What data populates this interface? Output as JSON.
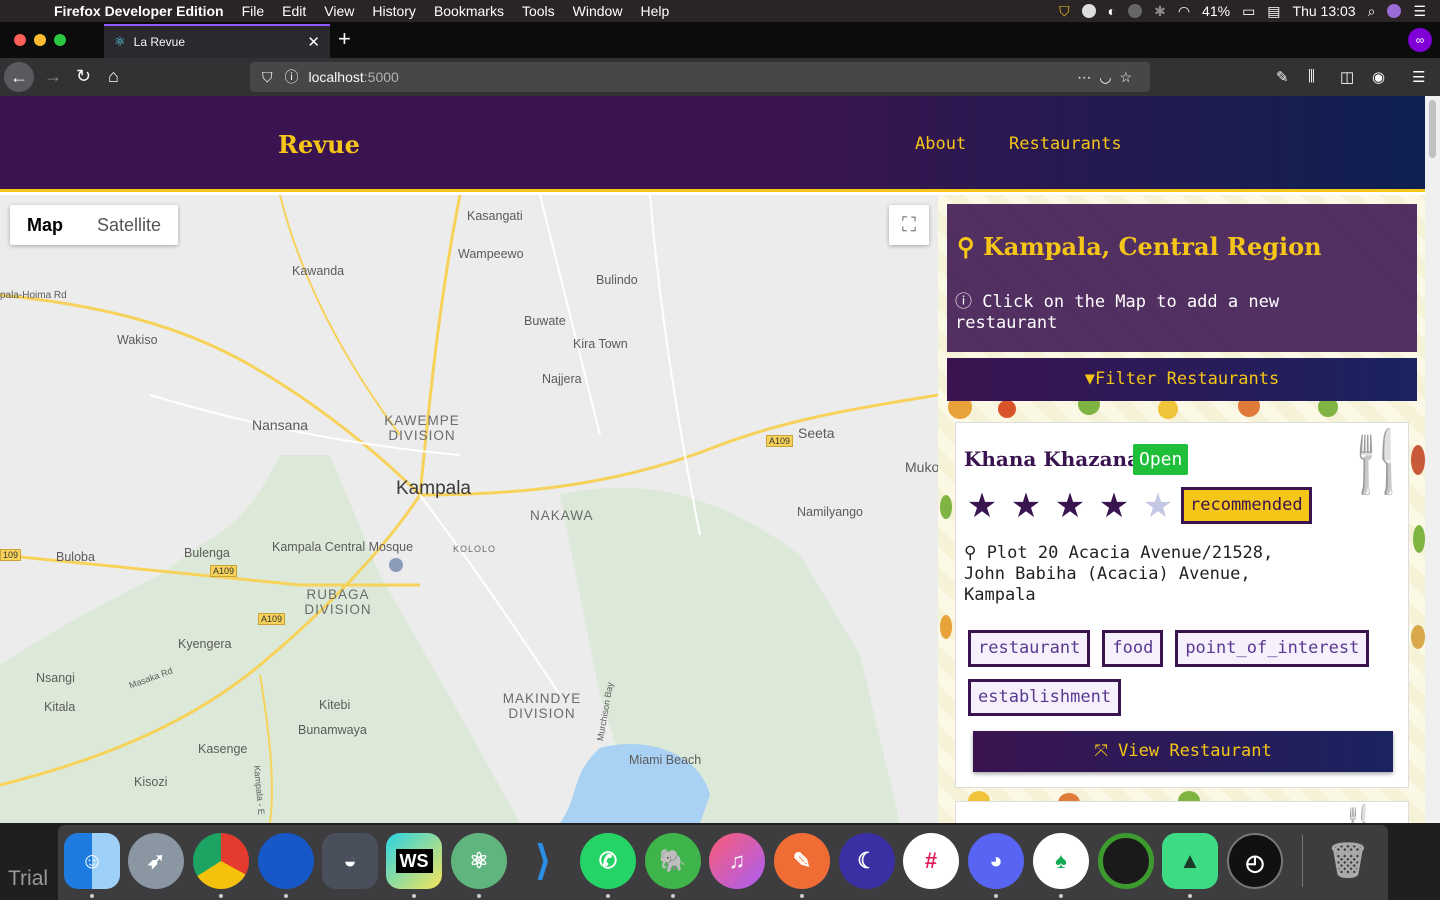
{
  "macos_menubar": {
    "app_name": "Firefox Developer Edition",
    "menus": [
      "File",
      "Edit",
      "View",
      "History",
      "Bookmarks",
      "Tools",
      "Window",
      "Help"
    ],
    "battery": "41%",
    "clock": "Thu 13:03"
  },
  "browser": {
    "tab_title": "La Revue",
    "url_host": "localhost",
    "url_port": ":5000"
  },
  "site": {
    "brand": "Revue",
    "nav": [
      "About",
      "Restaurants"
    ]
  },
  "map": {
    "type_buttons": [
      "Map",
      "Satellite"
    ],
    "selected_type": "Map",
    "labels": {
      "kasangati": "Kasangati",
      "wampeewo": "Wampeewo",
      "kawanda": "Kawanda",
      "bulindo": "Bulindo",
      "hoima_rd": "pala-Hoima Rd",
      "wakiso": "Wakiso",
      "buwate": "Buwate",
      "kira_town": "Kira Town",
      "najjera": "Najjera",
      "nansana": "Nansana",
      "kawempe": "KAWEMPE DIVISION",
      "seeta": "Seeta",
      "muko": "Muko",
      "kampala": "Kampala",
      "nakawa": "NAKAWA",
      "namilyango": "Namilyango",
      "buloba": "Buloba",
      "bulenga": "Bulenga",
      "mosque": "Kampala Central Mosque",
      "kololo": "KOLOLO",
      "rubaga": "RUBAGA DIVISION",
      "kyengera": "Kyengera",
      "miami_beach": "Miami Beach",
      "nsangi": "Nsangi",
      "masaka_rd": "Masaka Rd",
      "kitala": "Kitala",
      "kitebi": "Kitebi",
      "makindye": "MAKINDYE DIVISION",
      "bunamwaya": "Bunamwaya",
      "murchison_bay": "Murchison Bay",
      "kasenge": "Kasenge",
      "kisozi": "Kisozi",
      "kampala_e": "Kampala - E",
      "a109_1": "A109",
      "a109_2": "A109",
      "a109_3": "A109",
      "a109_4": "109"
    }
  },
  "location_panel": {
    "title": "Kampala, Central Region",
    "hint": "Click on the Map to add a new restaurant",
    "filter_button": "Filter Restaurants"
  },
  "restaurant": {
    "name": "Khana Khazana",
    "status": "Open",
    "rating": 4,
    "max_rating": 5,
    "badge": "recommended",
    "address": "Plot 20 Acacia Avenue/21528, John Babiha (Acacia) Avenue, Kampala",
    "tags": [
      "restaurant",
      "food",
      "point_of_interest",
      "establishment"
    ],
    "view_button": "View Restaurant"
  },
  "dock": {
    "trial_label": "Trial",
    "apps": [
      "finder-icon",
      "launchpad-icon",
      "chrome-icon",
      "firefox-icon",
      "notch-icon",
      "webstorm-icon",
      "atom-icon",
      "vscode-icon",
      "whatsapp-icon",
      "evernote-icon",
      "itunes-icon",
      "postman-icon",
      "moon-icon",
      "slack-icon",
      "discord-icon",
      "mongodb-icon",
      "loader-icon",
      "android-studio-icon",
      "clock-icon",
      "trash-icon"
    ],
    "webstorm_label": "WS"
  }
}
